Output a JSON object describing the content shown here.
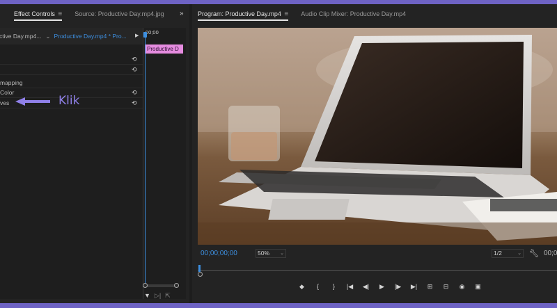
{
  "left_panel": {
    "tabs": [
      {
        "label": "Effect Controls",
        "active": true
      },
      {
        "label": "Source: Productive Day.mp4.jpg",
        "active": false
      }
    ],
    "expand_glyph": "»",
    "menu_glyph": "≡",
    "header": {
      "source": "ctive Day.mp4...",
      "clip": "Productive Day.mp4 * Pro..."
    },
    "timecode_ruler": "00;00",
    "clip_bar_label": "Productive D",
    "rows": [
      {
        "label": "",
        "reset": "⟲"
      },
      {
        "label": "",
        "reset": "⟲"
      },
      {
        "label": "mapping",
        "reset": ""
      },
      {
        "label": "Color",
        "reset": "⟲"
      },
      {
        "label": "ves",
        "reset": "⟲"
      }
    ],
    "reset_icon": "⟲"
  },
  "annotation": {
    "text": "Klik",
    "color": "#8f80e8"
  },
  "right_panel": {
    "tabs": [
      {
        "label": "Program: Productive Day.mp4",
        "active": true
      },
      {
        "label": "Audio Clip Mixer: Productive Day.mp4",
        "active": false
      }
    ],
    "menu_glyph": "≡",
    "timecode": "00;00;00;00",
    "zoom": "50%",
    "resolution": "1/2",
    "timecode_right": "00;0",
    "transport_buttons": [
      {
        "name": "marker-icon",
        "glyph": "◆"
      },
      {
        "name": "mark-in-icon",
        "glyph": "{"
      },
      {
        "name": "mark-out-icon",
        "glyph": "}"
      },
      {
        "name": "go-to-in-icon",
        "glyph": "|◀"
      },
      {
        "name": "step-back-icon",
        "glyph": "◀|"
      },
      {
        "name": "play-icon",
        "glyph": "▶"
      },
      {
        "name": "step-forward-icon",
        "glyph": "|▶"
      },
      {
        "name": "go-to-out-icon",
        "glyph": "▶|"
      },
      {
        "name": "insert-icon",
        "glyph": "⊞"
      },
      {
        "name": "overwrite-icon",
        "glyph": "⊟"
      },
      {
        "name": "export-frame-icon",
        "glyph": "◉"
      },
      {
        "name": "compare-icon",
        "glyph": "▣"
      }
    ]
  },
  "colors": {
    "accent": "#3d8fe0",
    "clip": "#e68ce0",
    "border": "#6e63c4"
  }
}
